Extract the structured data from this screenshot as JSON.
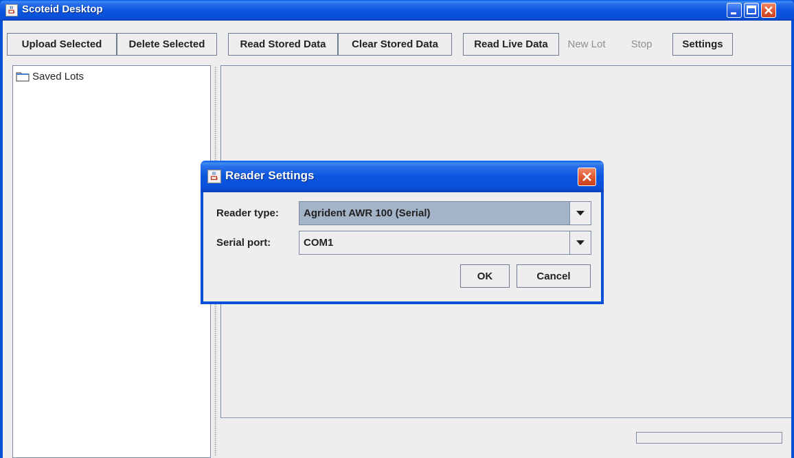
{
  "window": {
    "title": "Scoteid Desktop",
    "icon": "java-cup-icon"
  },
  "toolbar": {
    "upload_selected": "Upload Selected",
    "delete_selected": "Delete Selected",
    "read_stored_data": "Read Stored Data",
    "clear_stored_data": "Clear Stored Data",
    "read_live_data": "Read Live Data",
    "new_lot": "New Lot",
    "stop": "Stop",
    "settings": "Settings"
  },
  "tree": {
    "root_label": "Saved Lots",
    "root_icon": "folder-icon"
  },
  "dialog": {
    "title": "Reader Settings",
    "reader_type_label": "Reader type:",
    "reader_type_value": "Agrident AWR 100 (Serial)",
    "serial_port_label": "Serial port:",
    "serial_port_value": "COM1",
    "ok_label": "OK",
    "cancel_label": "Cancel"
  },
  "colors": {
    "titlebar_blue": "#0a4fd8",
    "close_red": "#e05a34",
    "panel_bg": "#eeeeee",
    "selected_combo": "#a3b3c8"
  }
}
